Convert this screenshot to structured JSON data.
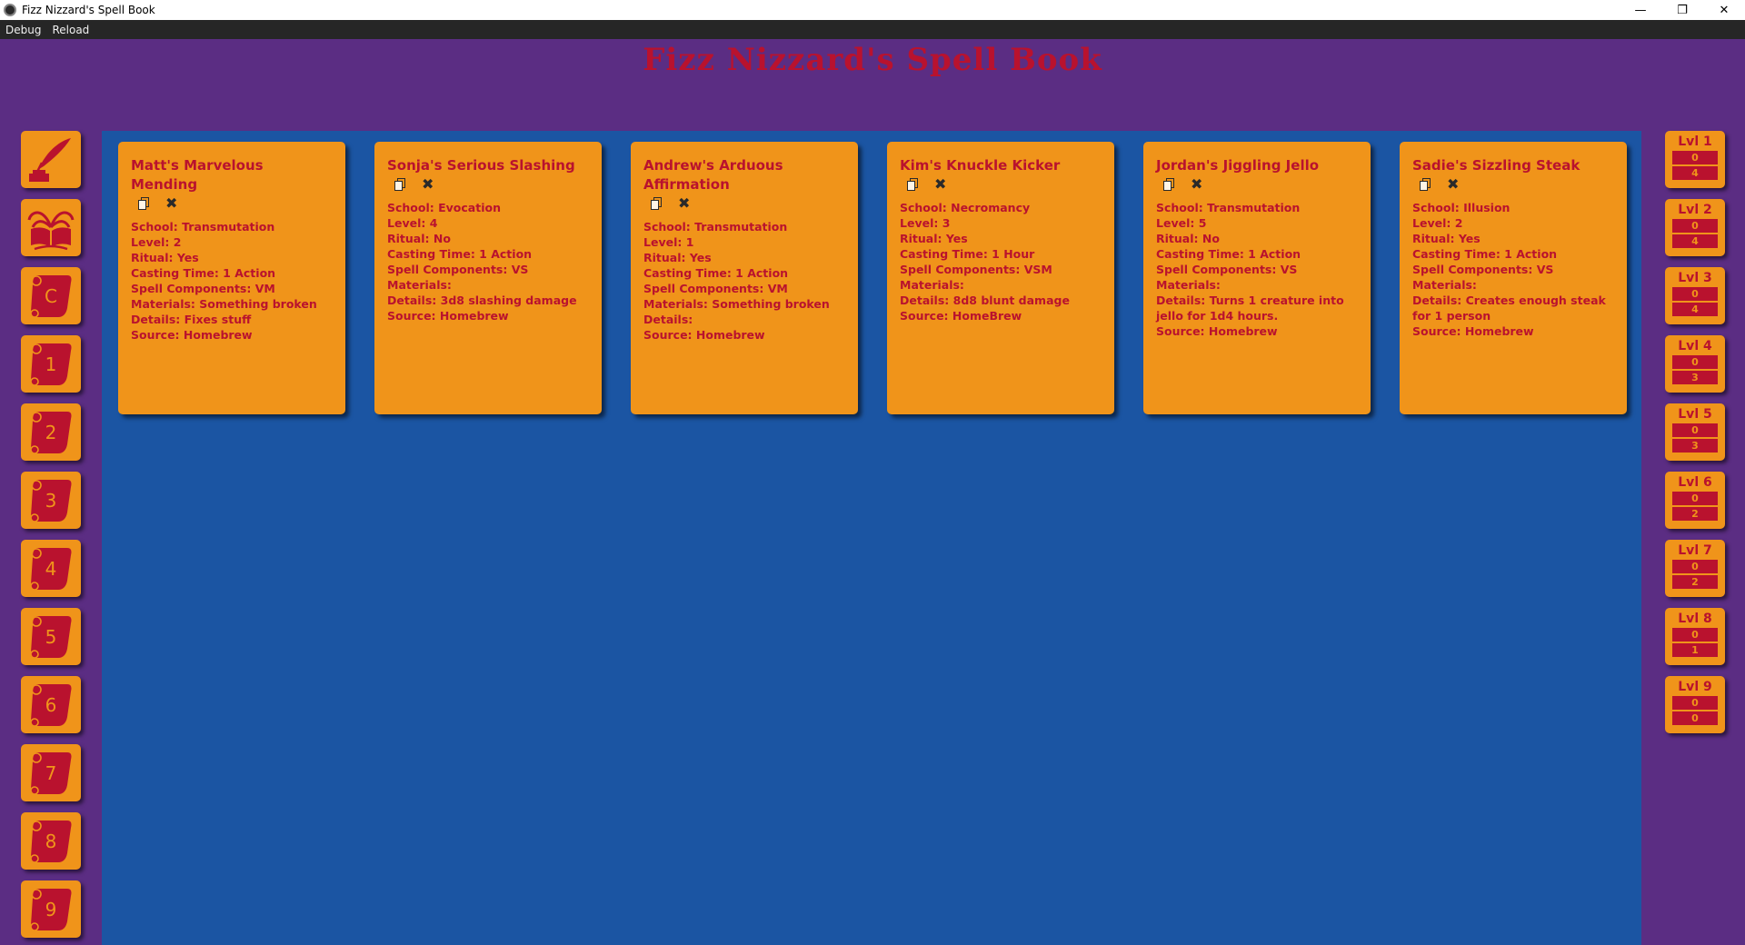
{
  "window": {
    "title": "Fizz Nizzard's Spell Book",
    "minimize": "—",
    "maximize": "❐",
    "close": "✕"
  },
  "menu": {
    "items": [
      "Debug",
      "Reload"
    ]
  },
  "app_title": "Fizz Nizzard's Spell Book",
  "colors": {
    "background": "#5b2d83",
    "panel": "#1b55a3",
    "card": "#f0941a",
    "accent": "#b9122e"
  },
  "left_nav": {
    "icons": [
      "quill-icon",
      "spellbook-icon",
      "scroll-icon",
      "scroll-icon",
      "scroll-icon",
      "scroll-icon",
      "scroll-icon",
      "scroll-icon",
      "scroll-icon",
      "scroll-icon",
      "scroll-icon",
      "scroll-icon"
    ],
    "scroll_labels": [
      "C",
      "1",
      "2",
      "3",
      "4",
      "5",
      "6",
      "7",
      "8",
      "9"
    ]
  },
  "spells": [
    {
      "name": "Matt's Marvelous Mending",
      "school": "School: Transmutation",
      "level": "Level: 2",
      "ritual": "Ritual: Yes",
      "casting_time": "Casting Time: 1 Action",
      "components": "Spell Components: VM",
      "materials": "Materials: Something broken",
      "details": "Details: Fixes stuff",
      "source": "Source: Homebrew"
    },
    {
      "name": "Sonja's Serious Slashing",
      "school": "School: Evocation",
      "level": "Level: 4",
      "ritual": "Ritual: No",
      "casting_time": "Casting Time: 1 Action",
      "components": "Spell Components: VS",
      "materials": "Materials:",
      "details": "Details: 3d8 slashing damage",
      "source": "Source: Homebrew"
    },
    {
      "name": "Andrew's Arduous Affirmation",
      "school": "School: Transmutation",
      "level": "Level: 1",
      "ritual": "Ritual: Yes",
      "casting_time": "Casting Time: 1 Action",
      "components": "Spell Components: VM",
      "materials": "Materials: Something broken",
      "details": "Details:",
      "source": "Source: Homebrew"
    },
    {
      "name": "Kim's Knuckle Kicker",
      "school": "School: Necromancy",
      "level": "Level: 3",
      "ritual": "Ritual: Yes",
      "casting_time": "Casting Time: 1 Hour",
      "components": "Spell Components: VSM",
      "materials": "Materials:",
      "details": "Details: 8d8 blunt damage",
      "source": "Source: HomeBrew"
    },
    {
      "name": "Jordan's Jiggling Jello",
      "school": "School: Transmutation",
      "level": "Level: 5",
      "ritual": "Ritual: No",
      "casting_time": "Casting Time: 1 Action",
      "components": "Spell Components: VS",
      "materials": "Materials:",
      "details": "Details: Turns 1 creature into jello for 1d4 hours.",
      "source": "Source: Homebrew"
    },
    {
      "name": "Sadie's Sizzling Steak",
      "school": "School: Illusion",
      "level": "Level: 2",
      "ritual": "Ritual: Yes",
      "casting_time": "Casting Time: 1 Action",
      "components": "Spell Components: VS",
      "materials": "Materials:",
      "details": "Details: Creates enough steak for 1 person",
      "source": "Source: Homebrew"
    }
  ],
  "spell_slots": [
    {
      "label": "Lvl 1",
      "used": "0",
      "total": "4"
    },
    {
      "label": "Lvl 2",
      "used": "0",
      "total": "4"
    },
    {
      "label": "Lvl 3",
      "used": "0",
      "total": "4"
    },
    {
      "label": "Lvl 4",
      "used": "0",
      "total": "3"
    },
    {
      "label": "Lvl 5",
      "used": "0",
      "total": "3"
    },
    {
      "label": "Lvl 6",
      "used": "0",
      "total": "2"
    },
    {
      "label": "Lvl 7",
      "used": "0",
      "total": "2"
    },
    {
      "label": "Lvl 8",
      "used": "0",
      "total": "1"
    },
    {
      "label": "Lvl 9",
      "used": "0",
      "total": "0"
    }
  ]
}
